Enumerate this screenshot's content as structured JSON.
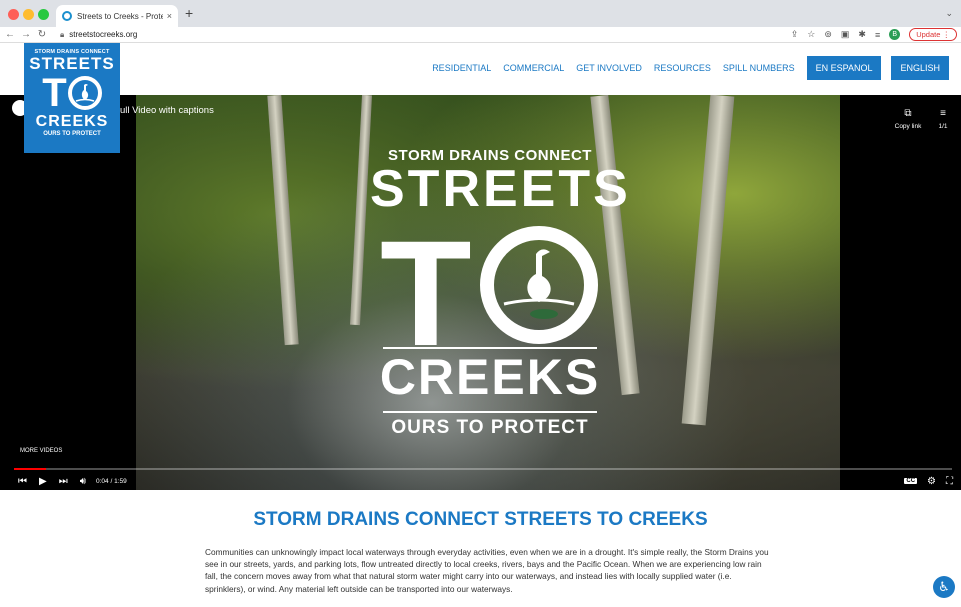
{
  "browser": {
    "tab_title": "Streets to Creeks - Protect Cre...",
    "tab_close": "×",
    "new_tab": "+",
    "url": "streetstocreeks.org",
    "update_label": "Update",
    "profile_initial": "B",
    "icons": [
      "back-icon",
      "forward-icon",
      "reload-icon",
      "lock-icon",
      "share-icon",
      "star-icon",
      "extension-icons",
      "update-menu-icon"
    ]
  },
  "logo": {
    "top": "STORM DRAINS CONNECT",
    "streets": "STREETS",
    "to": "T",
    "creeks": "CREEKS",
    "tagline": "OURS TO PROTECT"
  },
  "nav": {
    "items": [
      "RESIDENTIAL",
      "COMMERCIAL",
      "GET INVOLVED",
      "RESOURCES",
      "SPILL NUMBERS"
    ],
    "buttons": [
      "EN ESPANOL",
      "ENGLISH"
    ]
  },
  "video": {
    "title": "ull Video with captions",
    "copy_link": "Copy link",
    "playlist_count": "1/1",
    "more_videos": "MORE VIDEOS",
    "time": "0:04 / 1:59",
    "progress": 0.034,
    "cc": "CC",
    "brand_top": "STORM DRAINS CONNECT",
    "brand_streets": "STREETS",
    "brand_to": "T",
    "brand_creeks": "CREEKS",
    "brand_ours": "OURS TO PROTECT"
  },
  "article": {
    "heading": "STORM DRAINS CONNECT STREETS TO CREEKS",
    "body": "Communities can unknowingly impact local waterways through everyday activities, even when we are in a drought. It's simple really, the Storm Drains you see in our streets, yards, and parking lots, flow untreated directly to local creeks, rivers, bays and the Pacific Ocean. When we are experiencing low rain fall, the concern moves away from what that natural storm water might carry into our waterways, and instead lies with locally supplied water (i.e. sprinklers), or wind. Any material left outside can be transported into our waterways."
  },
  "colors": {
    "brand_blue": "#1b79c4",
    "progress_red": "#ff0000"
  }
}
